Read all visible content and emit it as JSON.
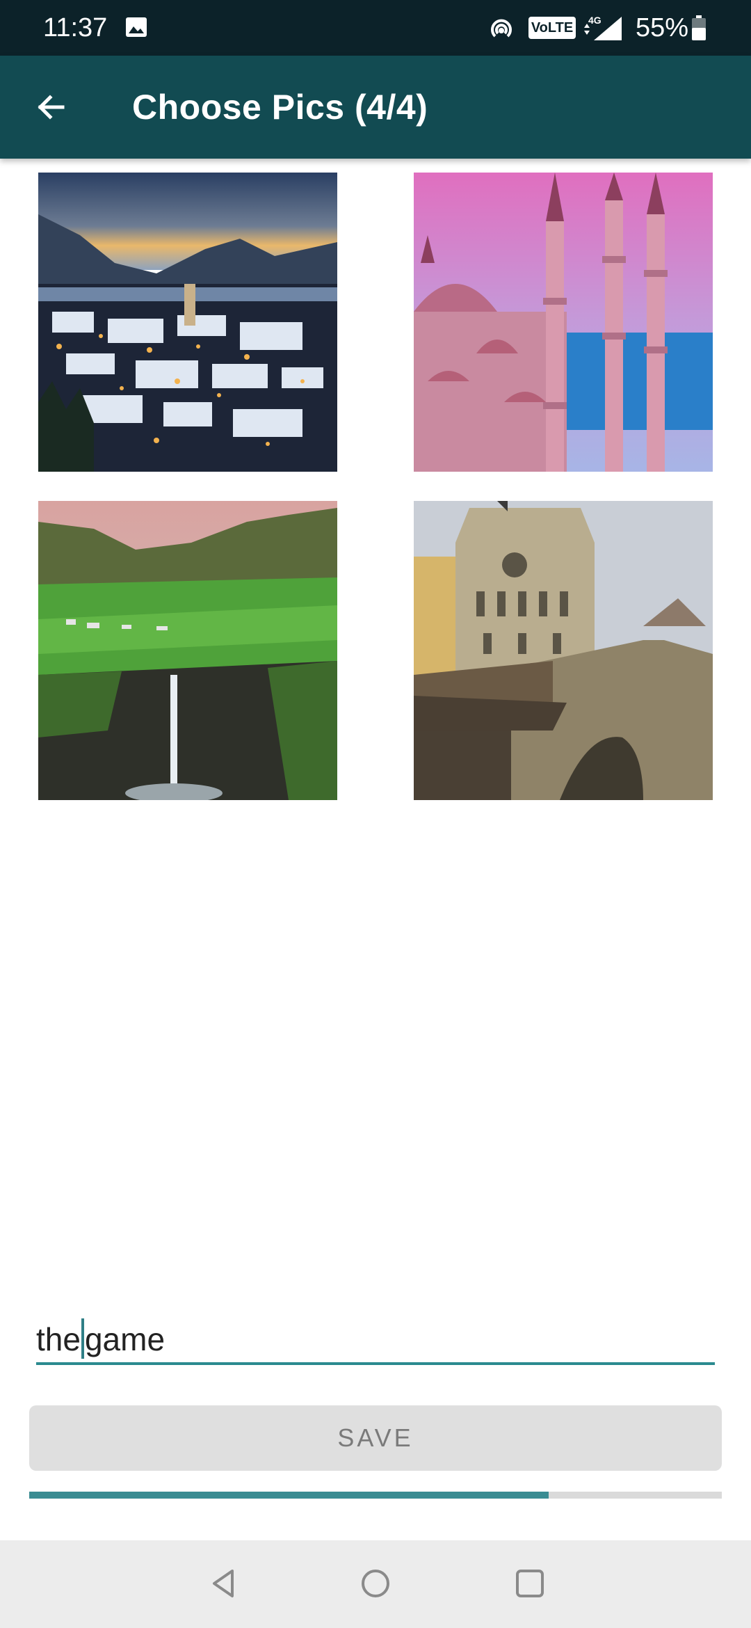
{
  "status_bar": {
    "time": "11:37",
    "network_badge": "VoLTE",
    "network_type": "4G",
    "battery": "55%",
    "icons": [
      "gallery-icon",
      "hotspot-icon",
      "signal-icon",
      "battery-icon"
    ]
  },
  "app_bar": {
    "title": "Choose Pics (4/4)",
    "back_icon": "arrow-left-icon"
  },
  "images": [
    {
      "name": "snowy-town-night"
    },
    {
      "name": "mosque-minarets-pink-sky"
    },
    {
      "name": "green-cliffs-waterfall"
    },
    {
      "name": "medieval-clock-tower"
    }
  ],
  "text_field": {
    "value_before_cursor": "the",
    "value_after_cursor": "game"
  },
  "save_button": {
    "label": "SAVE"
  },
  "progress": {
    "fraction": 0.75
  },
  "nav_bar": {
    "icons": [
      "nav-back-icon",
      "nav-home-icon",
      "nav-recents-icon"
    ]
  },
  "colors": {
    "status_bar": "#0c2229",
    "app_bar": "#124b52",
    "accent": "#2b8a8f",
    "button_bg": "#dfdfdf"
  }
}
